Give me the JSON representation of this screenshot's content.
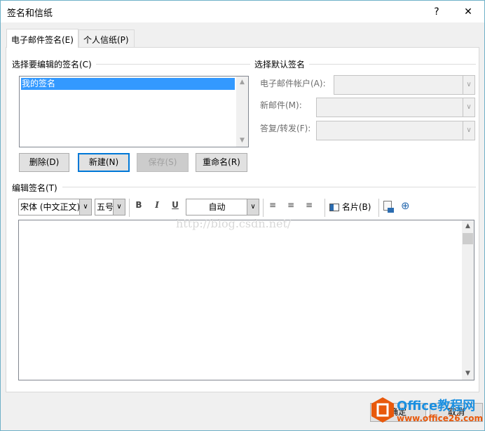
{
  "window": {
    "title": "签名和信纸",
    "help": "?",
    "close": "✕"
  },
  "tabs": [
    {
      "label": "电子邮件签名(E)"
    },
    {
      "label": "个人信纸(P)"
    }
  ],
  "select_group": {
    "label": "选择要编辑的签名(C)",
    "items": [
      "我的签名"
    ]
  },
  "buttons": {
    "delete": "删除(D)",
    "new": "新建(N)",
    "save": "保存(S)",
    "rename": "重命名(R)",
    "ok": "确定",
    "cancel": "取消"
  },
  "default_group": {
    "label": "选择默认签名",
    "account_label": "电子邮件帐户(A):",
    "new_label": "新邮件(M):",
    "reply_label": "答复/转发(F):"
  },
  "edit_group": {
    "label": "编辑签名(T)"
  },
  "toolbar": {
    "font": "宋体 (中文正文)",
    "size": "五号",
    "bold": "B",
    "italic": "I",
    "underline": "U",
    "color": "自动",
    "business_card": "名片(B)"
  },
  "watermark": "http://blog.csdn.net/",
  "logo": {
    "text": "Office教程网",
    "url": "www.office26.com"
  }
}
